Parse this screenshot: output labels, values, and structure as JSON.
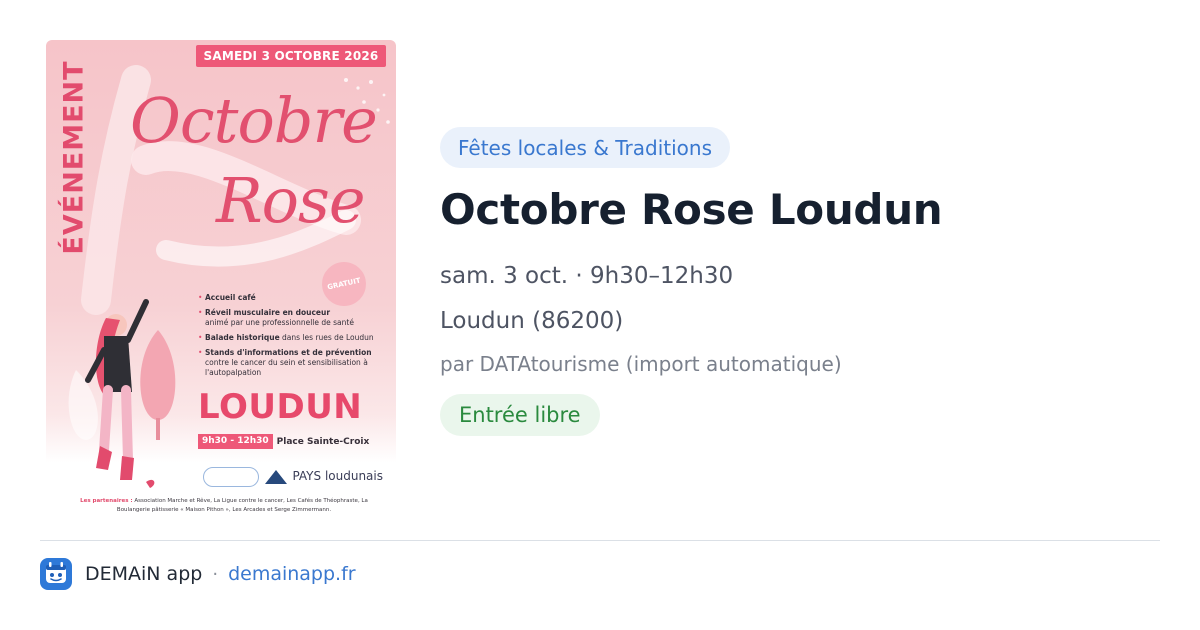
{
  "poster": {
    "vertical_label": "ÉVÉNEMENT",
    "date_banner": "SAMEDI 3 OCTOBRE 2026",
    "title_line1": "Octobre",
    "title_line2": "Rose",
    "badge": "GRATUIT",
    "activities": [
      {
        "title": "Accueil café",
        "detail": ""
      },
      {
        "title": "Réveil musculaire en douceur",
        "detail": "animé par une professionnelle de santé"
      },
      {
        "title": "Balade historique",
        "detail": "dans les rues de Loudun"
      },
      {
        "title": "Stands d'informations et de prévention",
        "detail": "contre le cancer du sein et sensibilisation à l'autopalpation"
      }
    ],
    "city": "LOUDUN",
    "time": "9h30 - 12h30",
    "place": "Place Sainte-Croix",
    "partner_logo_text": "PAYS loudunais",
    "partners_label": "Les partenaires :",
    "partners_text": "Association Marche et Rêve, La Ligue contre le cancer, Les Cafés de Théophraste, La Boulangerie pâtisserie « Maison Pithon », Les Arcades et Serge Zimmermann."
  },
  "event": {
    "category": "Fêtes locales & Traditions",
    "title": "Octobre Rose Loudun",
    "datetime": "sam. 3 oct. · 9h30–12h30",
    "location": "Loudun (86200)",
    "source": "par DATAtourisme (import automatique)",
    "price": "Entrée libre"
  },
  "footer": {
    "app_name": "DEMAiN app",
    "separator": "·",
    "link": "demainapp.fr"
  },
  "colors": {
    "accent_blue": "#3a78cf",
    "category_bg": "#eaf1fb",
    "price_green": "#2a8a3e",
    "price_bg": "#eaf6ec",
    "poster_pink": "#e2506f"
  },
  "icons": {
    "app_icon": "demain-app-icon"
  }
}
